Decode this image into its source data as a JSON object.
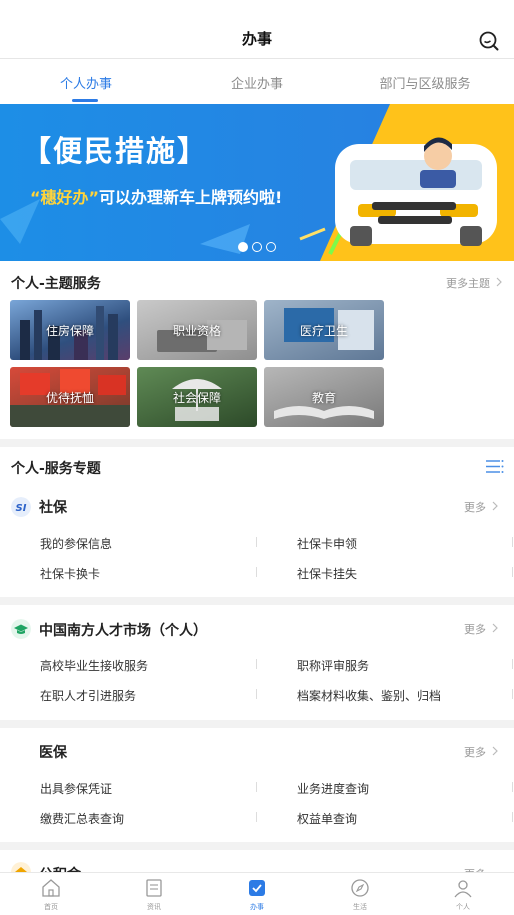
{
  "header": {
    "title": "办事"
  },
  "tabs": [
    {
      "label": "个人办事",
      "active": true
    },
    {
      "label": "企业办事",
      "active": false
    },
    {
      "label": "部门与区级服务",
      "active": false
    }
  ],
  "banner": {
    "title": "【便民措施】",
    "subtitle_highlight": "“穗好办”",
    "subtitle_rest": "可以办理新车上牌预约啦!",
    "pages": 3,
    "current_page": 1
  },
  "theme_services": {
    "title": "个人-主题服务",
    "more": "更多主题",
    "tiles": [
      {
        "label": "住房保障"
      },
      {
        "label": "职业资格"
      },
      {
        "label": "医疗卫生"
      },
      {
        "label": "优待抚恤"
      },
      {
        "label": "社会保障"
      },
      {
        "label": "教育"
      }
    ]
  },
  "service_topics": {
    "title": "个人-服务专题",
    "groups": [
      {
        "title": "社保",
        "more": "更多",
        "items": [
          "我的参保信息",
          "社保卡申领",
          "社保卡换卡",
          "社保卡挂失"
        ]
      },
      {
        "title": "中国南方人才市场（个人）",
        "more": "更多",
        "items": [
          "高校毕业生接收服务",
          "职称评审服务",
          "在职人才引进服务",
          "档案材料收集、鉴别、归档"
        ]
      },
      {
        "title": "医保",
        "more": "更多",
        "items": [
          "出具参保凭证",
          "业务进度查询",
          "缴费汇总表查询",
          "权益单查询"
        ]
      },
      {
        "title": "公积金",
        "more": "更多"
      }
    ]
  },
  "nav": [
    {
      "label": "首页",
      "icon": "home-icon"
    },
    {
      "label": "资讯",
      "icon": "news-icon"
    },
    {
      "label": "办事",
      "icon": "services-icon",
      "active": true
    },
    {
      "label": "生活",
      "icon": "compass-icon"
    },
    {
      "label": "个人",
      "icon": "user-icon"
    }
  ],
  "colors": {
    "accent": "#2c7be5",
    "banner_blue": "#1a8fe3",
    "banner_yellow": "#ffc21a"
  }
}
